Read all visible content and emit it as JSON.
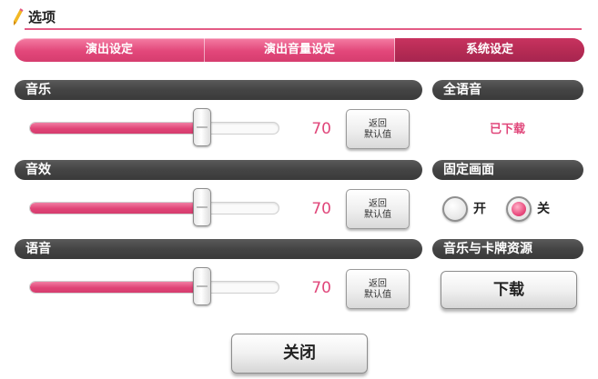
{
  "header": {
    "title": "选项",
    "icon": "pencil-icon",
    "accent": "#e35b85"
  },
  "tabs": [
    {
      "label": "演出设定",
      "active": false
    },
    {
      "label": "演出音量设定",
      "active": false
    },
    {
      "label": "系统设定",
      "active": true
    }
  ],
  "volume": {
    "reset_label_line1": "返回",
    "reset_label_line2": "默认值",
    "sliders": [
      {
        "label": "音乐",
        "value": "70"
      },
      {
        "label": "音效",
        "value": "70"
      },
      {
        "label": "语音",
        "value": "70"
      }
    ]
  },
  "voice_pack": {
    "label": "全语音",
    "status": "已下载"
  },
  "fixed_screen": {
    "label": "固定画面",
    "on_label": "开",
    "off_label": "关",
    "selected": "关"
  },
  "resources": {
    "label": "音乐与卡牌资源",
    "button": "下载"
  },
  "close_button": "关闭",
  "colors": {
    "pink": "#e0467a",
    "dark_bar": "#444444"
  }
}
